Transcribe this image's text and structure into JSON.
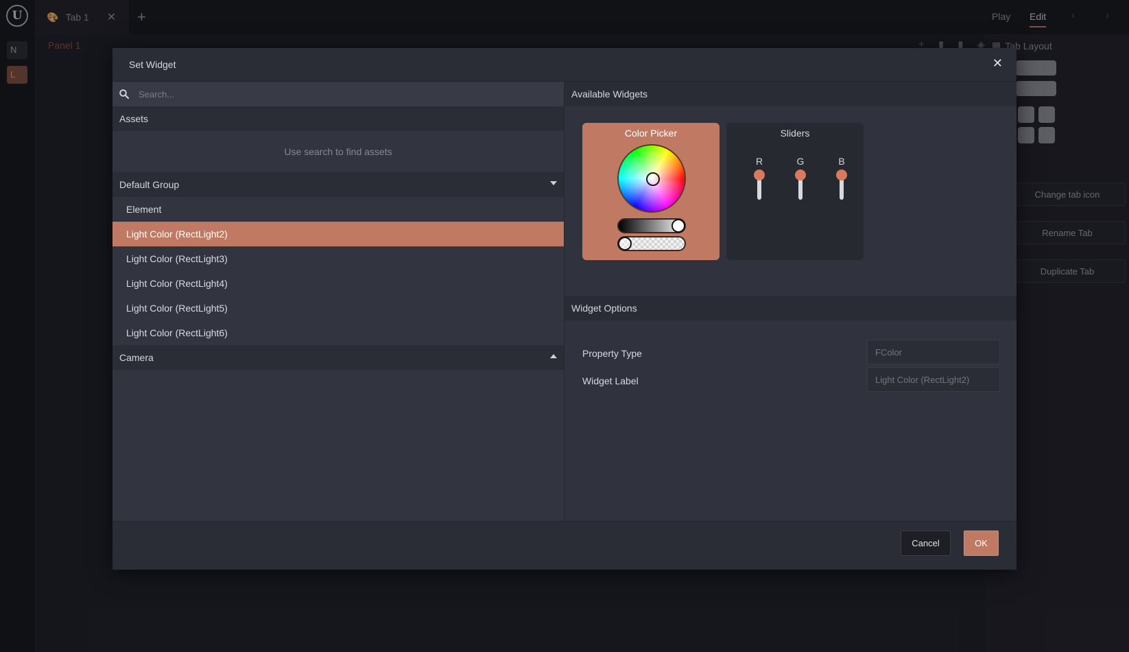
{
  "app": {
    "logo_letter": "U",
    "rail_buttons": [
      "N",
      "L"
    ],
    "tab_name": "Tab 1",
    "modes": {
      "play": "Play",
      "edit": "Edit"
    },
    "panel_name": "Panel 1"
  },
  "right_panel": {
    "title": "Tab Layout",
    "actions": [
      "Change tab icon",
      "Rename Tab",
      "Duplicate Tab"
    ]
  },
  "modal": {
    "title": "Set Widget",
    "search_placeholder": "Search...",
    "assets_header": "Assets",
    "assets_empty": "Use search to find assets",
    "groups": [
      {
        "name": "Default Group",
        "expanded": true,
        "items": [
          "Element",
          "Light Color (RectLight2)",
          "Light Color (RectLight3)",
          "Light Color (RectLight4)",
          "Light Color (RectLight5)",
          "Light Color (RectLight6)"
        ],
        "selected_index": 1
      },
      {
        "name": "Camera",
        "expanded": false
      }
    ],
    "available_widgets_header": "Available Widgets",
    "widgets": {
      "color_picker": "Color Picker",
      "sliders": {
        "title": "Sliders",
        "channels": [
          "R",
          "G",
          "B"
        ]
      }
    },
    "widget_options_header": "Widget Options",
    "options": {
      "property_type_label": "Property Type",
      "property_type_placeholder": "FColor",
      "widget_label_label": "Widget Label",
      "widget_label_placeholder": "Light Color (RectLight2)"
    },
    "cancel_label": "Cancel",
    "ok_label": "OK"
  },
  "colors": {
    "accent": "#c07a63",
    "modal_bg": "#2b2d36",
    "app_bg": "#1a1b20"
  }
}
